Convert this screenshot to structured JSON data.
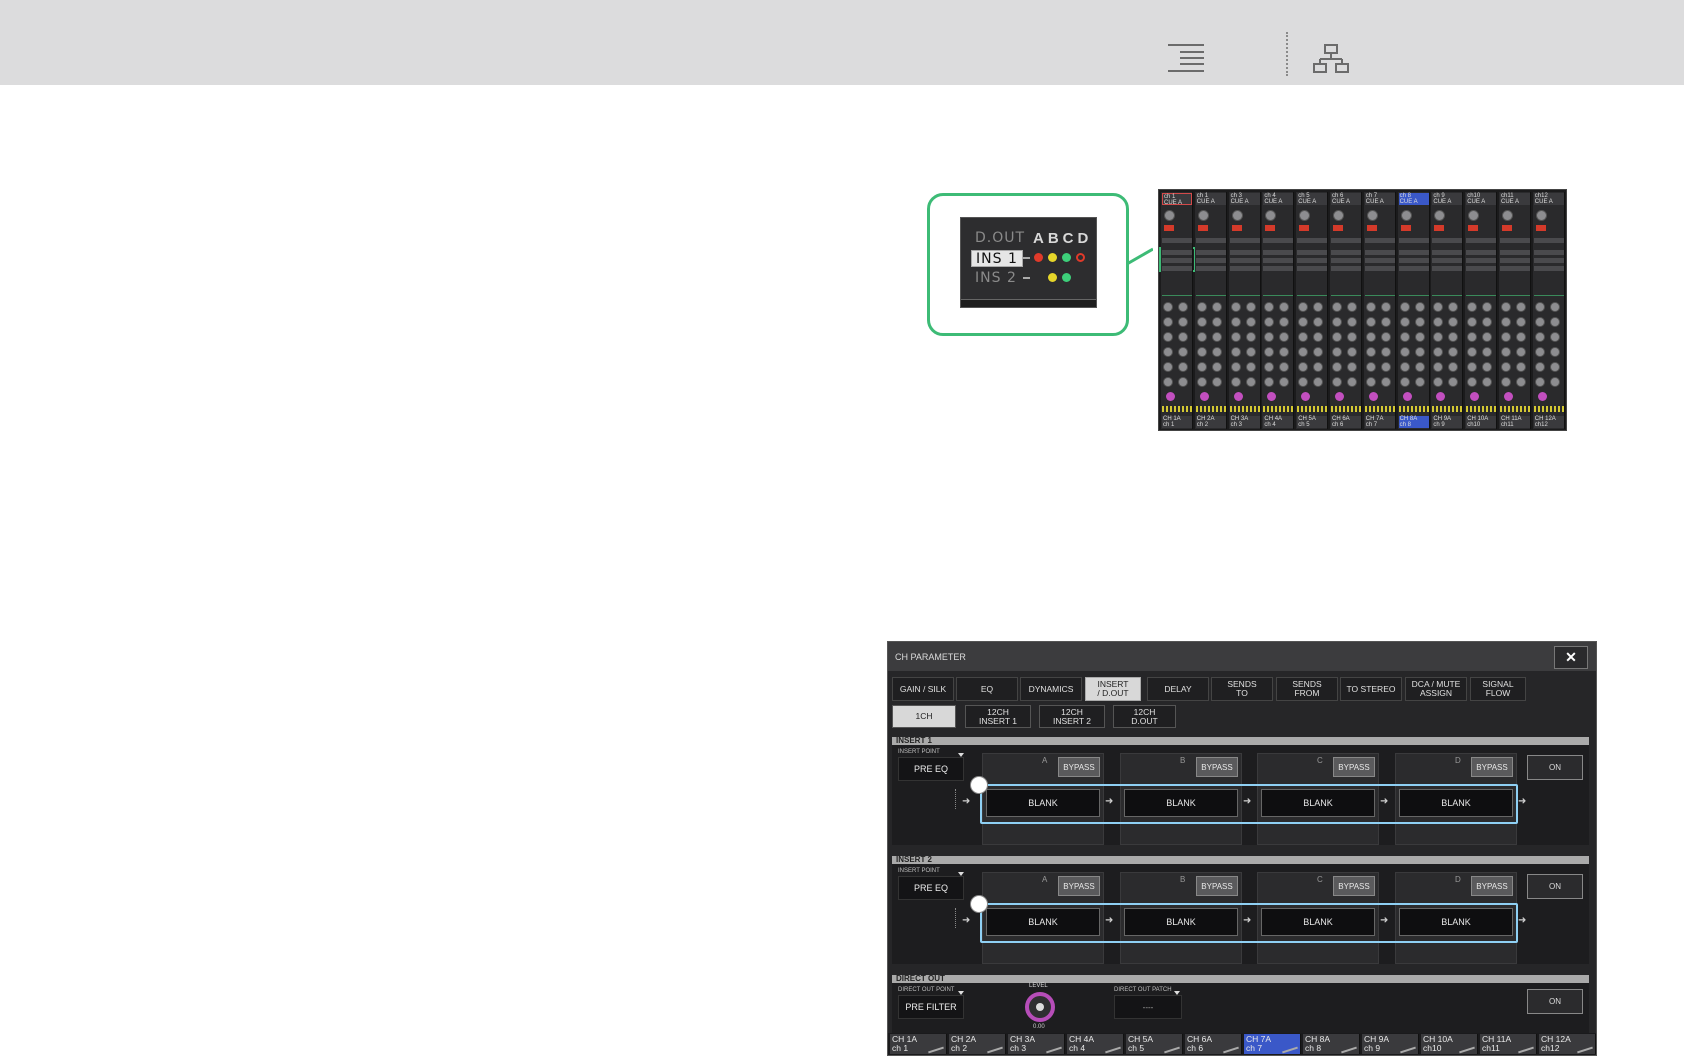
{
  "toolbar": {
    "toc_icon": "table-of-contents-icon",
    "tree_icon": "hierarchy-icon"
  },
  "callout": {
    "rows": [
      "D.OUT",
      "INS 1",
      "INS 2"
    ],
    "letters": "ABCD",
    "dot_colors_row1": [
      "#e03a2a",
      "#e6d62a",
      "#3dcf7a",
      "#e03a2a"
    ],
    "dot_colors_row2": [
      "#e6d62a",
      "#3dcf7a"
    ]
  },
  "mixer": {
    "strips": [
      {
        "head": "ch 1\nCUE A",
        "foot": "CH 1A\nch 1"
      },
      {
        "head": "ch 1\nCUE A",
        "foot": "CH 2A\nch 2"
      },
      {
        "head": "ch 3\nCUE A",
        "foot": "CH 3A\nch 3"
      },
      {
        "head": "ch 4\nCUE A",
        "foot": "CH 4A\nch 4"
      },
      {
        "head": "ch 5\nCUE A",
        "foot": "CH 5A\nch 5"
      },
      {
        "head": "ch 6\nCUE A",
        "foot": "CH 6A\nch 6"
      },
      {
        "head": "ch 7\nCUE A",
        "foot": "CH 7A\nch 7"
      },
      {
        "head": "ch 8\nCUE A",
        "foot": "CH 8A\nch 8"
      },
      {
        "head": "ch 9\nCUE A",
        "foot": "CH 9A\nch 9"
      },
      {
        "head": "ch10\nCUE A",
        "foot": "CH 10A\nch10"
      },
      {
        "head": "ch11\nCUE A",
        "foot": "CH 11A\nch11"
      },
      {
        "head": "ch12\nCUE A",
        "foot": "CH 12A\nch12"
      }
    ]
  },
  "window": {
    "title": "CH PARAMETER",
    "close": "✕",
    "tabs": [
      "GAIN / SILK",
      "EQ",
      "DYNAMICS",
      "INSERT\n/ D.OUT",
      "DELAY",
      "SENDS\nTO",
      "SENDS\nFROM",
      "TO STEREO",
      "DCA / MUTE\nASSIGN",
      "SIGNAL\nFLOW"
    ],
    "subtabs": [
      "1CH",
      "12CH\nINSERT 1",
      "12CH\nINSERT 2",
      "12CH\nD.OUT"
    ],
    "insert1": {
      "title": "INSERT 1",
      "point_label": "INSERT POINT",
      "point_value": "PRE EQ",
      "slots": [
        "A",
        "B",
        "C",
        "D"
      ],
      "bypass": "BYPASS",
      "blank": "BLANK",
      "on": "ON"
    },
    "insert2": {
      "title": "INSERT 2",
      "point_label": "INSERT POINT",
      "point_value": "PRE EQ",
      "slots": [
        "A",
        "B",
        "C",
        "D"
      ],
      "bypass": "BYPASS",
      "blank": "BLANK",
      "on": "ON"
    },
    "direct_out": {
      "title": "DIRECT OUT",
      "point_label": "DIRECT OUT POINT",
      "point_value": "PRE FILTER",
      "level_label": "LEVEL",
      "level_value": "0.00",
      "patch_label": "DIRECT OUT PATCH",
      "patch_value": "----",
      "on": "ON"
    },
    "channels": [
      {
        "top": "CH 1A",
        "bottom": "ch 1"
      },
      {
        "top": "CH 2A",
        "bottom": "ch 2"
      },
      {
        "top": "CH 3A",
        "bottom": "ch 3"
      },
      {
        "top": "CH 4A",
        "bottom": "ch 4"
      },
      {
        "top": "CH 5A",
        "bottom": "ch 5"
      },
      {
        "top": "CH 6A",
        "bottom": "ch 6"
      },
      {
        "top": "CH 7A",
        "bottom": "ch 7"
      },
      {
        "top": "CH 8A",
        "bottom": "ch 8"
      },
      {
        "top": "CH 9A",
        "bottom": "ch 9"
      },
      {
        "top": "CH 10A",
        "bottom": "ch10"
      },
      {
        "top": "CH 11A",
        "bottom": "ch11"
      },
      {
        "top": "CH 12A",
        "bottom": "ch12"
      }
    ],
    "selected_channel": 6,
    "highlight_color": "#8fd0f4"
  }
}
